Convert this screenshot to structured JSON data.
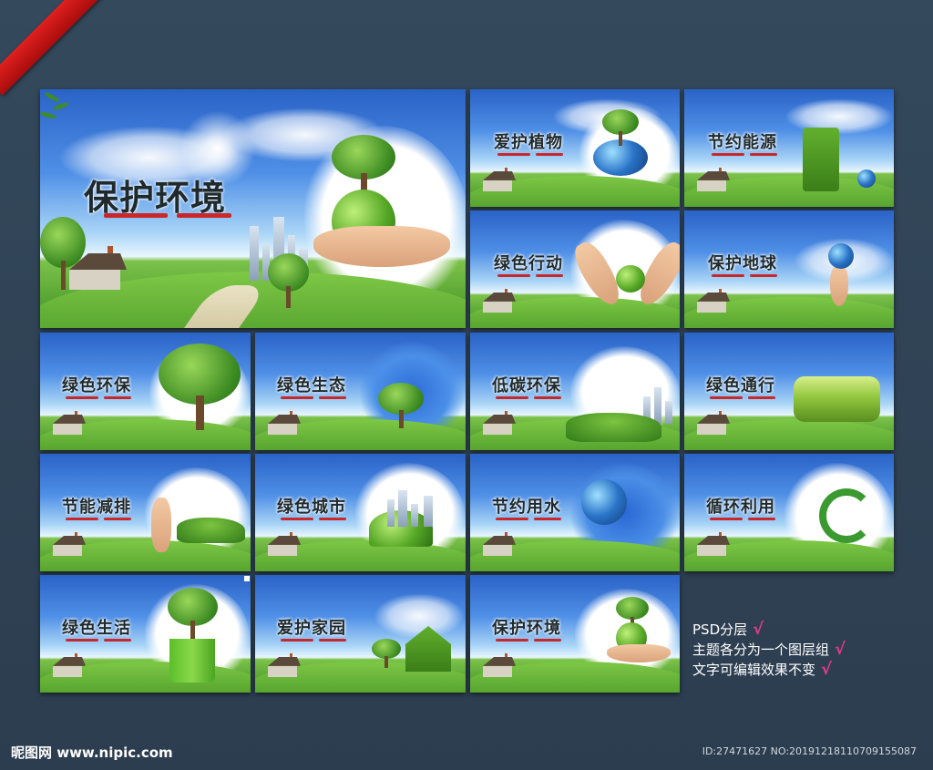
{
  "panels": [
    {
      "id": "p1",
      "title": "保护环境"
    },
    {
      "id": "p2",
      "title": "爱护植物"
    },
    {
      "id": "p3",
      "title": "节约能源"
    },
    {
      "id": "p4",
      "title": "绿色行动"
    },
    {
      "id": "p5",
      "title": "保护地球"
    },
    {
      "id": "p6",
      "title": "绿色环保"
    },
    {
      "id": "p7",
      "title": "绿色生态"
    },
    {
      "id": "p8",
      "title": "低碳环保"
    },
    {
      "id": "p9",
      "title": "绿色通行"
    },
    {
      "id": "p10",
      "title": "节能减排"
    },
    {
      "id": "p11",
      "title": "绿色城市"
    },
    {
      "id": "p12",
      "title": "节约用水"
    },
    {
      "id": "p13",
      "title": "循环利用"
    },
    {
      "id": "p14",
      "title": "绿色生活"
    },
    {
      "id": "p15",
      "title": "爱护家园"
    },
    {
      "id": "p16",
      "title": "保护环境"
    }
  ],
  "legend": {
    "line1": "PSD分层",
    "line2": "主题各分为一个图层组",
    "line3": "文字可编辑效果不变",
    "check": "√"
  },
  "footer": {
    "logo": "昵图网 www.nipic.com",
    "id": "ID:27471627 NO:20191218110709155087"
  },
  "colors": {
    "background": "#2f4153",
    "accent": "#e23a8c",
    "ribbon": "#c81414"
  }
}
